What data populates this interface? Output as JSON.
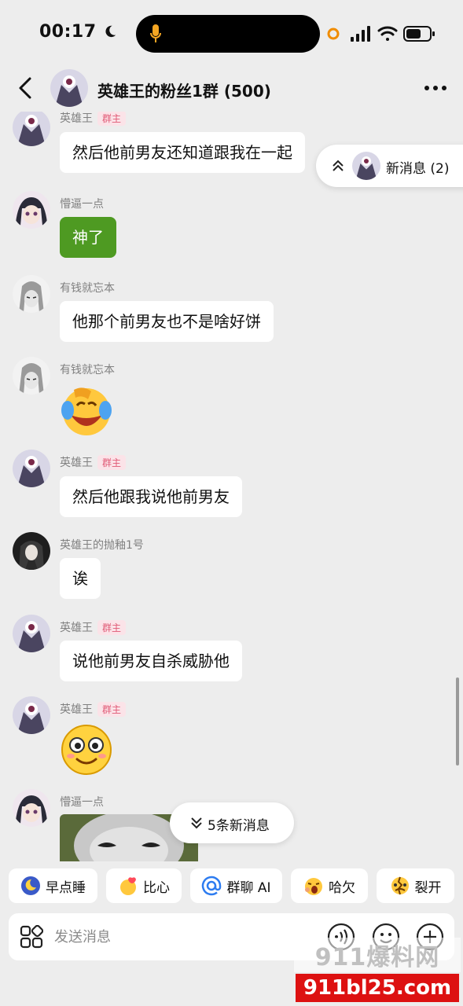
{
  "status": {
    "time": "00:17"
  },
  "header": {
    "title": "英雄王的粉丝1群 (500)"
  },
  "messages": [
    {
      "name": "英雄王",
      "badge": "群主",
      "text": "然后他前男友还知道跟我在一起"
    },
    {
      "name": "懵逼一点",
      "text": "神了"
    },
    {
      "name": "有钱就忘本",
      "text": "他那个前男友也不是啥好饼"
    },
    {
      "name": "有钱就忘本",
      "sticker": "laughing-crying-emoji"
    },
    {
      "name": "英雄王",
      "badge": "群主",
      "text": "然后他跟我说他前男友"
    },
    {
      "name": "英雄王的抛釉1号",
      "text": "诶"
    },
    {
      "name": "英雄王",
      "badge": "群主",
      "text": "说他前男友自杀威胁他"
    },
    {
      "name": "英雄王",
      "badge": "群主",
      "sticker": "smiling-face-emoji"
    },
    {
      "name": "懵逼一点",
      "sticker": "cat-photo"
    }
  ],
  "new_messages_top": {
    "label": "新消息 (2)"
  },
  "new_messages_bottom": {
    "label": "5条新消息"
  },
  "quick_replies": [
    {
      "label": "早点睡",
      "icon": "moon-sleep-icon"
    },
    {
      "label": "比心",
      "icon": "heart-hands-icon"
    },
    {
      "label": "群聊 AI",
      "icon": "at-icon"
    },
    {
      "label": "哈欠",
      "icon": "yawn-icon"
    },
    {
      "label": "裂开",
      "icon": "crack-face-icon"
    }
  ],
  "composer": {
    "placeholder": "发送消息"
  },
  "watermark": {
    "top": "911爆料网",
    "bottom": "911bl25.com"
  },
  "colors": {
    "background": "#ededed",
    "green_bubble": "#4e9a22",
    "badge_text": "#e05a76",
    "badge_bg": "#fbe3e8"
  }
}
